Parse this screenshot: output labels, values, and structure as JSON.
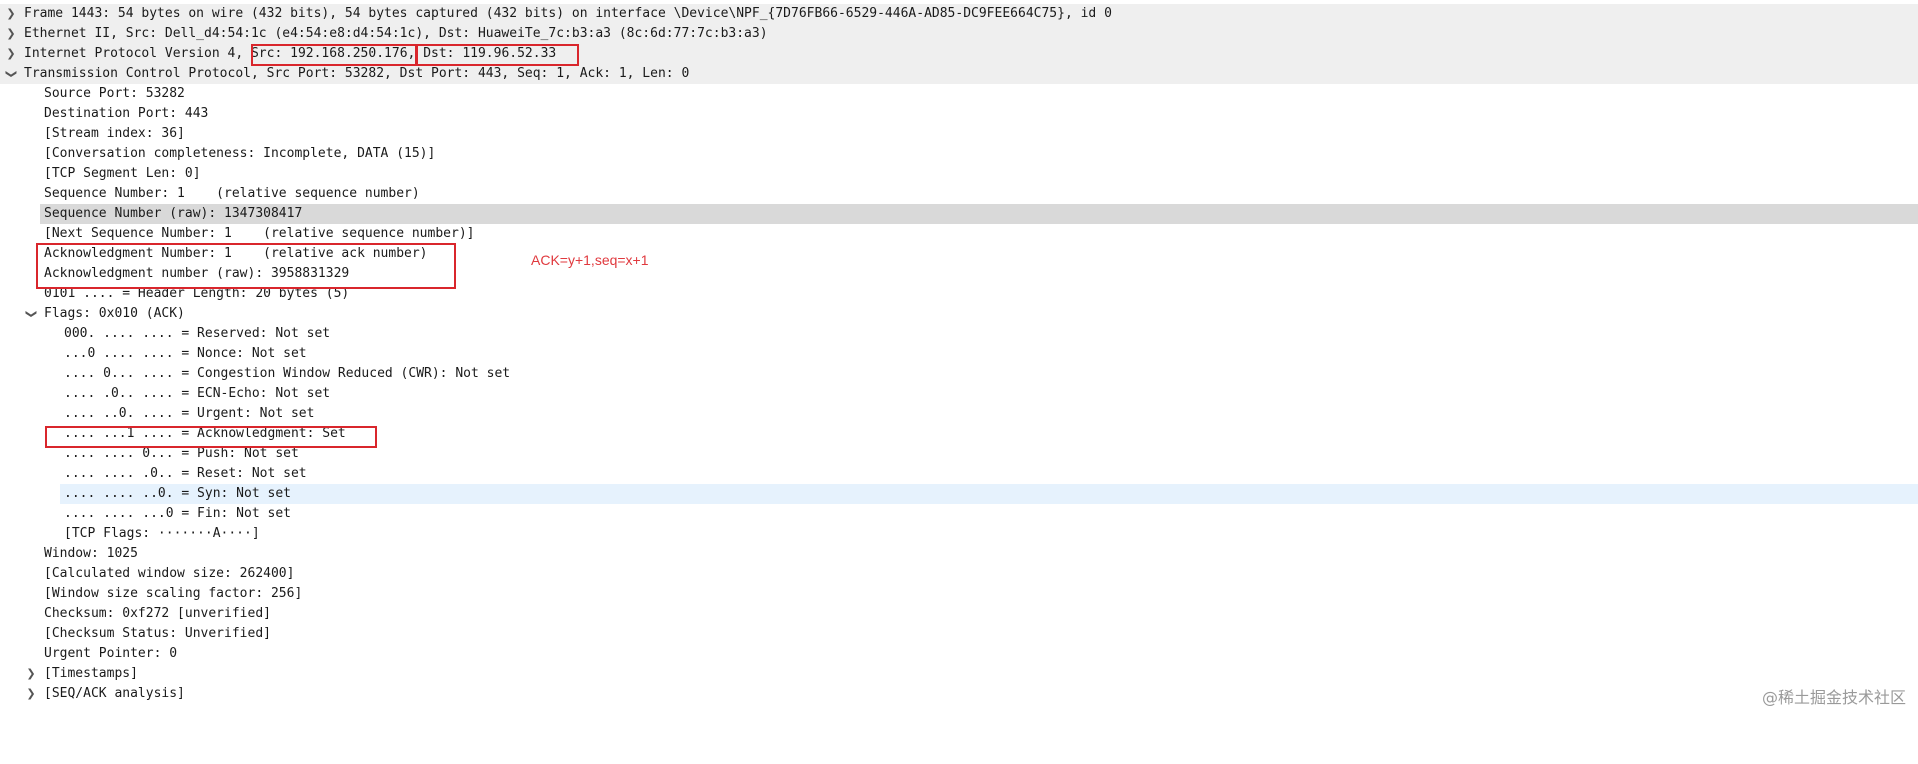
{
  "packet_details": {
    "frame": "Frame 1443: 54 bytes on wire (432 bits), 54 bytes captured (432 bits) on interface \\Device\\NPF_{7D76FB66-6529-446A-AD85-DC9FEE664C75}, id 0",
    "ethernet": "Ethernet II, Src: Dell_d4:54:1c (e4:54:e8:d4:54:1c), Dst: HuaweiTe_7c:b3:a3 (8c:6d:77:7c:b3:a3)",
    "ip_prefix": "Internet Protocol Version 4, ",
    "ip_src": "Src: 192.168.250.176",
    "ip_sep": ", ",
    "ip_dst": "Dst: 119.96.52.33",
    "tcp": "Transmission Control Protocol, Src Port: 53282, Dst Port: 443, Seq: 1, Ack: 1, Len: 0",
    "tcp_fields": {
      "source_port": "Source Port: 53282",
      "destination_port": "Destination Port: 443",
      "stream_index": "[Stream index: 36]",
      "conversation": "[Conversation completeness: Incomplete, DATA (15)]",
      "segment_len": "[TCP Segment Len: 0]",
      "seq_number": "Sequence Number: 1    (relative sequence number)",
      "seq_raw": "Sequence Number (raw): 1347308417",
      "next_seq": "[Next Sequence Number: 1    (relative sequence number)]",
      "ack_number": "Acknowledgment Number: 1    (relative ack number)",
      "ack_raw": "Acknowledgment number (raw): 3958831329",
      "header_length": "0101 .... = Header Length: 20 bytes (5)",
      "flags": "Flags: 0x010 (ACK)",
      "window": "Window: 1025",
      "calc_window": "[Calculated window size: 262400]",
      "window_scaling": "[Window size scaling factor: 256]",
      "checksum": "Checksum: 0xf272 [unverified]",
      "checksum_status": "[Checksum Status: Unverified]",
      "urgent_pointer": "Urgent Pointer: 0",
      "timestamps": "[Timestamps]",
      "seq_ack_analysis": "[SEQ/ACK analysis]"
    },
    "flag_bits": {
      "reserved": "000. .... .... = Reserved: Not set",
      "nonce": "...0 .... .... = Nonce: Not set",
      "cwr": ".... 0... .... = Congestion Window Reduced (CWR): Not set",
      "ecn": ".... .0.. .... = ECN-Echo: Not set",
      "urgent": ".... ..0. .... = Urgent: Not set",
      "ack": ".... ...1 .... = Acknowledgment: Set",
      "push": ".... .... 0... = Push: Not set",
      "reset": ".... .... .0.. = Reset: Not set",
      "syn": ".... .... ..0. = Syn: Not set",
      "fin": ".... .... ...0 = Fin: Not set",
      "tcp_flags": "[TCP Flags: ·······A····]"
    }
  },
  "annotation": "ACK=y+1,seq=x+1",
  "watermark": "@稀土掘金技术社区",
  "icons": {
    "collapsed": "chevron-right-icon",
    "expanded": "chevron-down-icon"
  },
  "colors": {
    "annotation_red": "#e0393e",
    "box_red": "#d9262c",
    "selected_row": "#d9d9d9",
    "hover_row": "#e6f2fd"
  }
}
